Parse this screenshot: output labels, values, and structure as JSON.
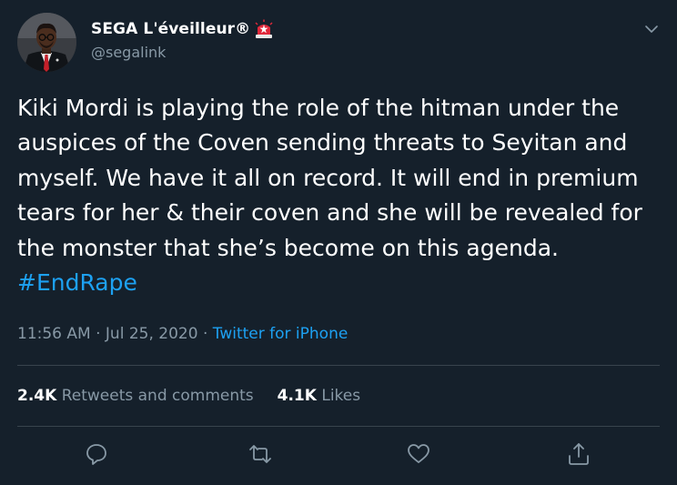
{
  "user": {
    "display_name": "SEGA L'éveilleur®",
    "handle": "@segalink",
    "badge_icon": "rotating-light-icon"
  },
  "tweet": {
    "text": "Kiki Mordi is playing the role of the hitman under the auspices of the Coven sending threats to Seyitan and myself. We have it all on record. It will end in premium tears for her & their coven and she will be revealed for the monster that she’s become on this agenda.",
    "hashtag": "#EndRape"
  },
  "meta": {
    "time": "11:56 AM",
    "separator": "·",
    "date": "Jul 25, 2020",
    "source": "Twitter for iPhone"
  },
  "stats": {
    "retweets_count": "2.4K",
    "retweets_label": "Retweets and comments",
    "likes_count": "4.1K",
    "likes_label": "Likes"
  },
  "actions": [
    "reply-icon",
    "retweet-icon",
    "like-icon",
    "share-icon"
  ],
  "colors": {
    "background": "#15202b",
    "text": "#ffffff",
    "secondary": "#8899a6",
    "link": "#1da1f2",
    "divider": "#38444d"
  }
}
